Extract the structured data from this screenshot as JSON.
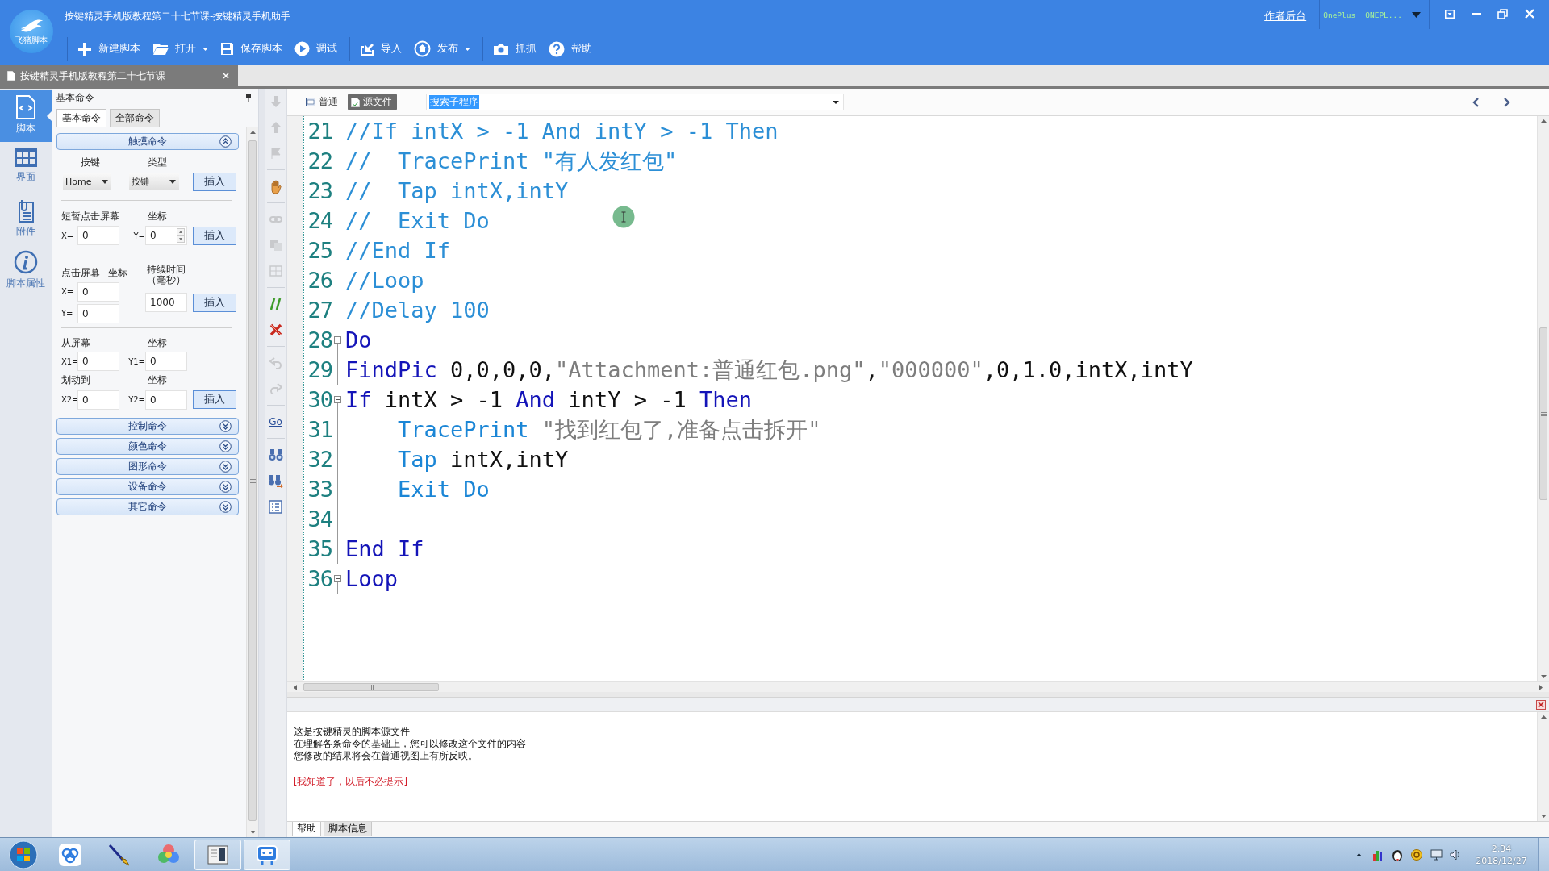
{
  "window": {
    "title": "按键精灵手机版教程第二十七节课-按键精灵手机助手",
    "logo_caption": "飞猪脚本",
    "author_link": "作者后台",
    "device": {
      "brand": "OnePlus",
      "model": "ONEPL..."
    }
  },
  "toolbar": [
    {
      "kind": "button",
      "label": "新建脚本",
      "dropdown": false
    },
    {
      "kind": "button",
      "label": "打开",
      "dropdown": true
    },
    {
      "kind": "button",
      "label": "保存脚本",
      "dropdown": false
    },
    {
      "kind": "button",
      "label": "调试",
      "dropdown": false
    },
    {
      "kind": "separator"
    },
    {
      "kind": "button",
      "label": "导入",
      "dropdown": false
    },
    {
      "kind": "button",
      "label": "发布",
      "dropdown": true
    },
    {
      "kind": "separator"
    },
    {
      "kind": "button",
      "label": "抓抓",
      "dropdown": false
    },
    {
      "kind": "button",
      "label": "帮助",
      "dropdown": false
    }
  ],
  "document_tab": {
    "title": "按键精灵手机版教程第二十七节课"
  },
  "nav": [
    {
      "label": "脚本",
      "selected": true
    },
    {
      "label": "界面",
      "selected": false
    },
    {
      "label": "附件",
      "selected": false
    },
    {
      "label": "脚本属性",
      "selected": false
    }
  ],
  "command_panel": {
    "title": "基本命令",
    "tabs": [
      {
        "label": "基本命令",
        "selected": true
      },
      {
        "label": "全部命令",
        "selected": false
      }
    ],
    "sections": [
      {
        "title": "触摸命令",
        "expanded": true,
        "groups": [
          {
            "kind": "key",
            "key_label": "按键",
            "type_label": "类型",
            "key_value": "Home",
            "type_value": "按键",
            "button": "插入"
          },
          {
            "kind": "tap",
            "title": "短暂点击屏幕",
            "coord_label": "坐标",
            "x": {
              "prefix": "X=",
              "value": "0"
            },
            "y": {
              "prefix": "Y=",
              "value": "0"
            },
            "button": "插入"
          },
          {
            "kind": "hold",
            "title": "点击屏幕",
            "coord_label": "坐标",
            "duration_label": "持续时间（毫秒）",
            "x": {
              "prefix": "X=",
              "value": "0"
            },
            "y": {
              "prefix": "Y=",
              "value": "0"
            },
            "duration": "1000",
            "button": "插入"
          },
          {
            "kind": "swipe",
            "from_label": "从屏幕",
            "from_coord_label": "坐标",
            "x1": {
              "prefix": "X1=",
              "value": "0"
            },
            "y1": {
              "prefix": "Y1=",
              "value": "0"
            },
            "to_label": "划动到",
            "to_coord_label": "坐标",
            "x2": {
              "prefix": "X2=",
              "value": "0"
            },
            "y2": {
              "prefix": "Y2=",
              "value": "0"
            },
            "button": "插入"
          }
        ]
      },
      {
        "title": "控制命令",
        "expanded": false
      },
      {
        "title": "颜色命令",
        "expanded": false
      },
      {
        "title": "图形命令",
        "expanded": false
      },
      {
        "title": "设备命令",
        "expanded": false
      },
      {
        "title": "其它命令",
        "expanded": false
      }
    ]
  },
  "tools": [
    {
      "kind": "arrow-down",
      "disabled": true
    },
    {
      "kind": "arrow-up",
      "disabled": true
    },
    {
      "kind": "flag",
      "disabled": true
    },
    {
      "kind": "separator"
    },
    {
      "kind": "hand",
      "disabled": false
    },
    {
      "kind": "separator"
    },
    {
      "kind": "chain",
      "disabled": true
    },
    {
      "kind": "copy",
      "disabled": true
    },
    {
      "kind": "panels",
      "disabled": true
    },
    {
      "kind": "separator"
    },
    {
      "kind": "comment",
      "disabled": false
    },
    {
      "kind": "uncomment",
      "disabled": false
    },
    {
      "kind": "separator"
    },
    {
      "kind": "undo",
      "disabled": true
    },
    {
      "kind": "redo",
      "disabled": true
    },
    {
      "kind": "separator"
    },
    {
      "kind": "goto",
      "label": "Go",
      "disabled": false
    },
    {
      "kind": "separator"
    },
    {
      "kind": "find",
      "disabled": false
    },
    {
      "kind": "find-next",
      "disabled": false
    },
    {
      "kind": "list",
      "disabled": false
    }
  ],
  "editor": {
    "view_tabs": [
      {
        "label": "普通",
        "selected": false
      },
      {
        "label": "源文件",
        "selected": true
      }
    ],
    "search": {
      "value": "搜索子程序",
      "highlighted": true
    },
    "lines": [
      {
        "number": "21",
        "collapsible": false,
        "tokens": [
          {
            "kind": "comment",
            "text": "//If intX > -1 And intY > -1 Then"
          }
        ]
      },
      {
        "number": "22",
        "collapsible": false,
        "tokens": [
          {
            "kind": "comment",
            "text": "//  TracePrint \"有人发红包\""
          }
        ]
      },
      {
        "number": "23",
        "collapsible": false,
        "tokens": [
          {
            "kind": "comment",
            "text": "//  Tap intX,intY"
          }
        ]
      },
      {
        "number": "24",
        "collapsible": false,
        "tokens": [
          {
            "kind": "comment",
            "text": "//  Exit Do"
          }
        ]
      },
      {
        "number": "25",
        "collapsible": false,
        "tokens": [
          {
            "kind": "comment",
            "text": "//End If"
          }
        ]
      },
      {
        "number": "26",
        "collapsible": false,
        "tokens": [
          {
            "kind": "comment",
            "text": "//Loop"
          }
        ]
      },
      {
        "number": "27",
        "collapsible": false,
        "tokens": [
          {
            "kind": "comment",
            "text": "//Delay 100"
          }
        ]
      },
      {
        "number": "28",
        "collapsible": true,
        "tokens": [
          {
            "kind": "keyword",
            "text": "Do"
          }
        ]
      },
      {
        "number": "29",
        "collapsible": false,
        "tokens": [
          {
            "kind": "keyword",
            "text": "FindPic"
          },
          {
            "kind": "plain",
            "text": " 0,0,0,0,"
          },
          {
            "kind": "string",
            "text": "\"Attachment:普通红包.png\""
          },
          {
            "kind": "plain",
            "text": ","
          },
          {
            "kind": "string",
            "text": "\"000000\""
          },
          {
            "kind": "plain",
            "text": ",0,1.0,intX,intY"
          }
        ]
      },
      {
        "number": "30",
        "collapsible": true,
        "tokens": [
          {
            "kind": "keyword",
            "text": "If"
          },
          {
            "kind": "plain",
            "text": " intX > -1 "
          },
          {
            "kind": "keyword",
            "text": "And"
          },
          {
            "kind": "plain",
            "text": " intY > -1 "
          },
          {
            "kind": "keyword",
            "text": "Then"
          }
        ]
      },
      {
        "number": "31",
        "collapsible": false,
        "tokens": [
          {
            "kind": "command",
            "text": "    TracePrint"
          },
          {
            "kind": "string",
            "text": " \"找到红包了,准备点击拆开\""
          }
        ]
      },
      {
        "number": "32",
        "collapsible": false,
        "tokens": [
          {
            "kind": "command",
            "text": "    Tap"
          },
          {
            "kind": "plain",
            "text": " intX,intY"
          }
        ]
      },
      {
        "number": "33",
        "collapsible": false,
        "tokens": [
          {
            "kind": "command",
            "text": "    Exit Do"
          }
        ]
      },
      {
        "number": "34",
        "collapsible": false
      },
      {
        "number": "35",
        "collapsible": false,
        "tokens": [
          {
            "kind": "keyword",
            "text": "End If"
          }
        ]
      },
      {
        "number": "36",
        "collapsible": true,
        "tokens": [
          {
            "kind": "keyword",
            "text": "Loop"
          }
        ]
      }
    ]
  },
  "help_panel": {
    "lines": [
      "这是按键精灵的脚本源文件",
      "在理解各条命令的基础上，您可以修改这个文件的内容",
      "您修改的结果将会在普通视图上有所反映。"
    ],
    "link": "[我知道了，以后不必提示]",
    "tabs": [
      {
        "label": "帮助",
        "selected": true
      },
      {
        "label": "脚本信息",
        "selected": false
      }
    ]
  },
  "taskbar": {
    "apps": [
      {
        "open": false,
        "selected": false
      },
      {
        "open": false,
        "selected": false
      },
      {
        "open": false,
        "selected": false
      },
      {
        "open": true,
        "selected": false
      },
      {
        "open": true,
        "selected": true
      }
    ],
    "clock": {
      "time": "2:34",
      "date": "2018/12/27"
    }
  }
}
